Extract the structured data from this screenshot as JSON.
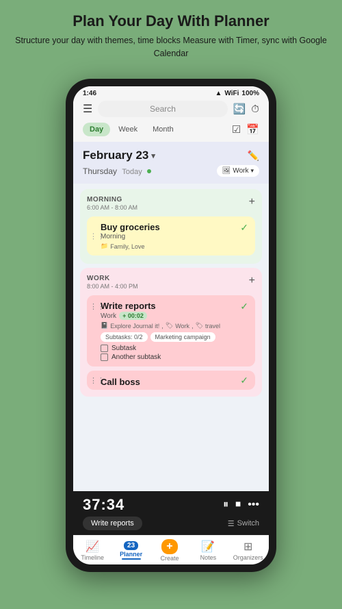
{
  "header": {
    "title": "Plan Your Day With Planner",
    "subtitle": "Structure your day with themes, time blocks\nMeasure with Timer, sync with Google Calendar"
  },
  "statusBar": {
    "time": "1:46",
    "battery": "100%",
    "signal": "▲▼"
  },
  "topNav": {
    "search_placeholder": "Search"
  },
  "tabs": {
    "items": [
      "Day",
      "Week",
      "Month"
    ],
    "active": "Day"
  },
  "dateHeader": {
    "date": "February 23",
    "day": "Thursday",
    "today_label": "Today",
    "work_label": "Work"
  },
  "morningSection": {
    "title": "MORNING",
    "time": "6:00 AM - 8:00 AM",
    "task": {
      "title": "Buy groceries",
      "subtitle": "Morning",
      "tags": "Family, Love",
      "checked": true
    }
  },
  "workSection": {
    "title": "WORK",
    "time": "8:00 AM - 4:00 PM",
    "task1": {
      "title": "Write reports",
      "subtitle": "Work",
      "timer": "+ 00:02",
      "journal_tag": "Explore Journal it!",
      "work_tag": "Work",
      "travel_tag": "travel",
      "subtasks_label": "Subtasks: 0/2",
      "marketing_label": "Marketing campaign",
      "subtask1": "Subtask",
      "subtask2": "Another subtask",
      "checked": true
    },
    "task2": {
      "title": "Call boss"
    }
  },
  "timer": {
    "time": "37:34",
    "task_label": "Write reports",
    "switch_label": "Switch"
  },
  "bottomNav": {
    "items": [
      {
        "label": "Timeline",
        "icon": "📈"
      },
      {
        "label": "Planner",
        "icon": "📅",
        "badge": "23",
        "active": true
      },
      {
        "label": "Create",
        "icon": "＋"
      },
      {
        "label": "Notes",
        "icon": "📝"
      },
      {
        "label": "Organizers",
        "icon": "⊞"
      }
    ]
  }
}
